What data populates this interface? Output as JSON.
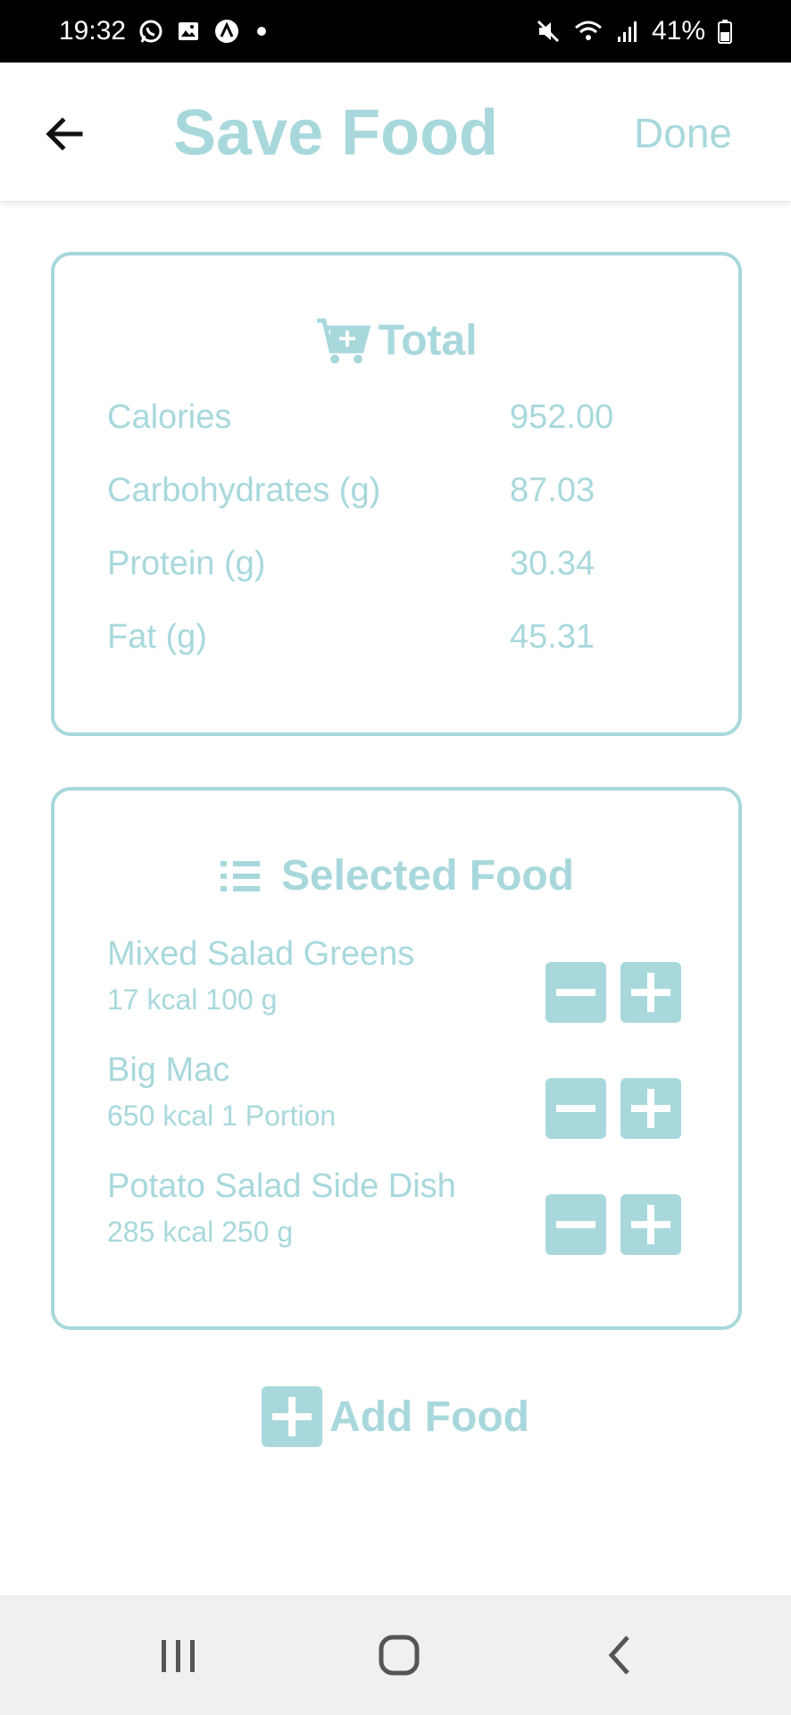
{
  "status_bar": {
    "time": "19:32",
    "battery_percent": "41%",
    "icons": [
      "whatsapp-icon",
      "gallery-icon",
      "app-icon",
      "dot-icon",
      "mute-icon",
      "wifi-icon",
      "signal-icon",
      "battery-icon"
    ]
  },
  "app_bar": {
    "title": "Save Food",
    "done_label": "Done",
    "back_icon": "arrow-left-icon"
  },
  "total_card": {
    "title": "Total",
    "icon": "cart-plus-icon",
    "rows": [
      {
        "label": "Calories",
        "value": "952.00"
      },
      {
        "label": "Carbohydrates (g)",
        "value": "87.03"
      },
      {
        "label": "Protein (g)",
        "value": "30.34"
      },
      {
        "label": "Fat (g)",
        "value": "45.31"
      }
    ]
  },
  "selected_card": {
    "title": "Selected Food",
    "icon": "list-icon",
    "items": [
      {
        "name": "Mixed Salad Greens",
        "info": "17 kcal 100 g"
      },
      {
        "name": "Big Mac",
        "info": "650 kcal 1 Portion"
      },
      {
        "name": "Potato Salad Side Dish",
        "info": "285 kcal 250 g"
      }
    ]
  },
  "add_food": {
    "label": "Add Food",
    "icon": "plus-square-icon"
  },
  "nav_bar": {
    "icons": [
      "recents-icon",
      "home-icon",
      "back-icon"
    ]
  },
  "colors": {
    "accent": "#a8d8dc",
    "status_bar_bg": "#000000",
    "nav_bar_bg": "#f0f0f0"
  }
}
